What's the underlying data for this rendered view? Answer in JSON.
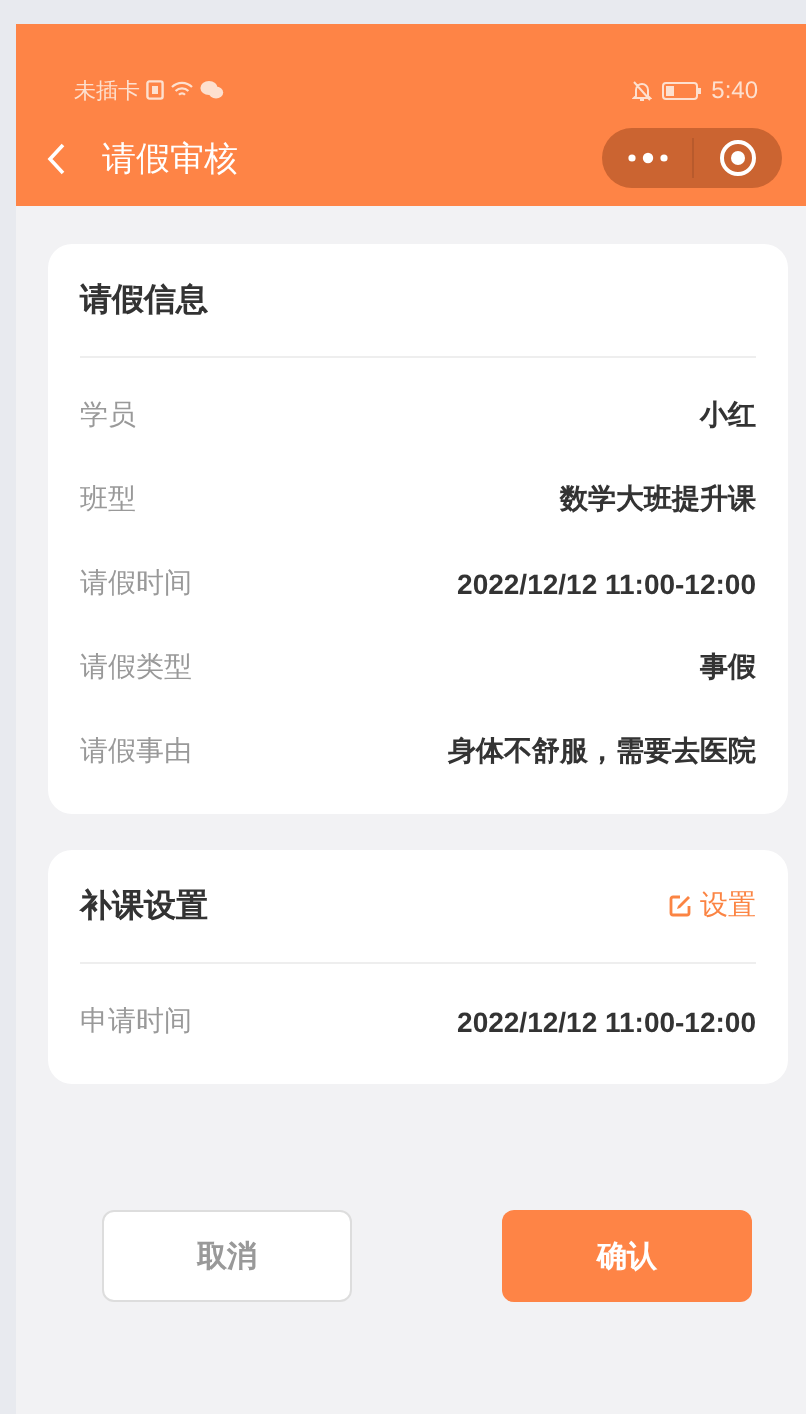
{
  "status_bar": {
    "carrier": "未插卡",
    "time": "5:40"
  },
  "nav": {
    "title": "请假审核"
  },
  "leave_info": {
    "title": "请假信息",
    "rows": [
      {
        "label": "学员",
        "value": "小红"
      },
      {
        "label": "班型",
        "value": "数学大班提升课"
      },
      {
        "label": "请假时间",
        "value": "2022/12/12 11:00-12:00"
      },
      {
        "label": "请假类型",
        "value": "事假"
      },
      {
        "label": "请假事由",
        "value": "身体不舒服，需要去医院"
      }
    ]
  },
  "makeup": {
    "title": "补课设置",
    "action": "设置",
    "rows": [
      {
        "label": "申请时间",
        "value": "2022/12/12 11:00-12:00"
      }
    ]
  },
  "buttons": [
    {
      "label": "取消",
      "kind": "secondary"
    },
    {
      "label": "确认",
      "kind": "primary"
    }
  ]
}
